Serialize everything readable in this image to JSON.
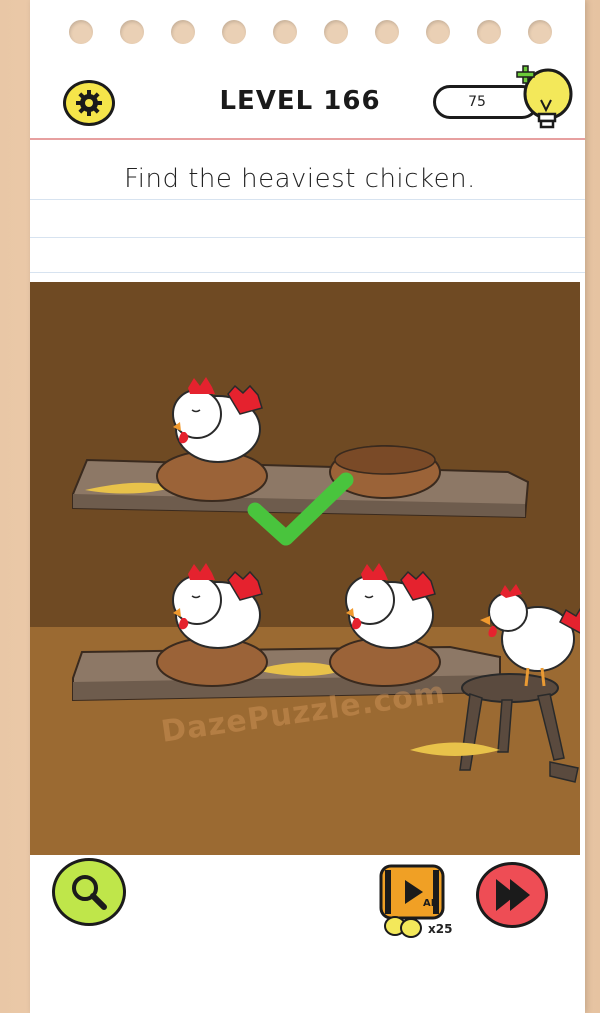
{
  "header": {
    "level_label": "LEVEL 166",
    "hint_count": "75"
  },
  "question": "Find the heaviest chicken.",
  "watermark": "DazePuzzle.com",
  "bottom": {
    "ad_multiplier": "x25",
    "ad_badge": "AD"
  },
  "colors": {
    "scene_wall": "#6f4a23",
    "scene_floor": "#9b6a32",
    "shelf": "#8d7866",
    "nest": "#9b6338",
    "check": "#49c43d",
    "search_button": "#bfe64a",
    "next_button": "#ee4d55",
    "settings_button": "#f5e54a"
  },
  "icons": [
    "gear-icon",
    "lightbulb-plus-icon",
    "search-icon",
    "video-ad-icon",
    "next-arrow-icon",
    "checkmark-icon"
  ]
}
